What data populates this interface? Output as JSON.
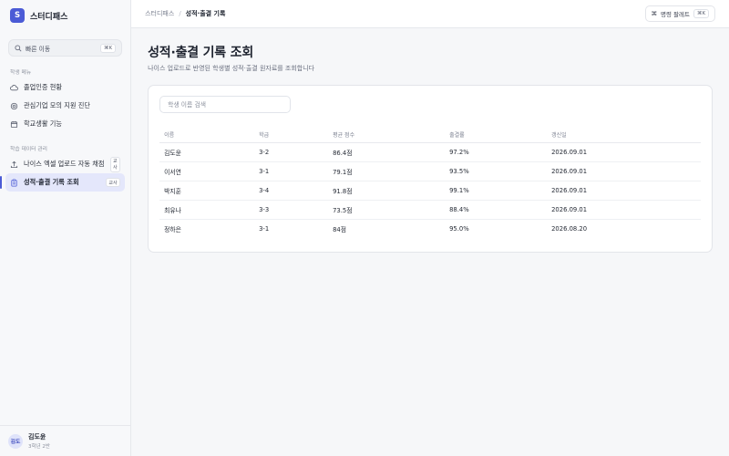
{
  "brand": {
    "logo_letter": "S",
    "name": "스터디패스"
  },
  "sidebar": {
    "quick_search": {
      "label": "빠른 이동",
      "shortcut": "⌘K"
    },
    "sections": [
      {
        "title": "학생 메뉴",
        "items": [
          {
            "label": "졸업인증 현황",
            "icon": "cloud-icon"
          },
          {
            "label": "관심기업 모의 지원 진단",
            "icon": "target-icon"
          },
          {
            "label": "학교생활 기능",
            "icon": "calendar-icon"
          }
        ]
      },
      {
        "title": "학습 데이터 관리",
        "items": [
          {
            "label": "나이스 엑셀 업로드 자동 채점",
            "icon": "upload-icon",
            "badge": "교사"
          },
          {
            "label": "성적·출결 기록 조회",
            "icon": "clipboard-icon",
            "badge": "교사",
            "active": true
          }
        ]
      }
    ],
    "user": {
      "avatar": "김도",
      "name": "김도윤",
      "meta": "3학년 2반"
    }
  },
  "topbar": {
    "breadcrumb": [
      "스터디패스",
      "성적·출결 기록"
    ],
    "separator": "/",
    "command": {
      "icon_glyph": "⌘",
      "label": "명령 팔레트",
      "shortcut": "⌘K"
    }
  },
  "page": {
    "title": "성적·출결 기록 조회",
    "subtitle": "나이스 업로드로 반영된 학생별 성적·출결 원자료를 조회합니다"
  },
  "search": {
    "placeholder": "학생 이름 검색"
  },
  "table": {
    "headers": [
      "이름",
      "학급",
      "평균 점수",
      "출결률",
      "갱신일"
    ],
    "rows": [
      [
        "김도윤",
        "3-2",
        "86.4점",
        "97.2%",
        "2026.09.01"
      ],
      [
        "이서연",
        "3-1",
        "79.1점",
        "93.5%",
        "2026.09.01"
      ],
      [
        "박지훈",
        "3-4",
        "91.8점",
        "99.1%",
        "2026.09.01"
      ],
      [
        "최유나",
        "3-3",
        "73.5점",
        "88.4%",
        "2026.09.01"
      ],
      [
        "정하은",
        "3-1",
        "84점",
        "95.0%",
        "2026.08.20"
      ]
    ]
  },
  "colors": {
    "accent": "#4b5bd6",
    "active_bg": "#e4e7fb"
  }
}
